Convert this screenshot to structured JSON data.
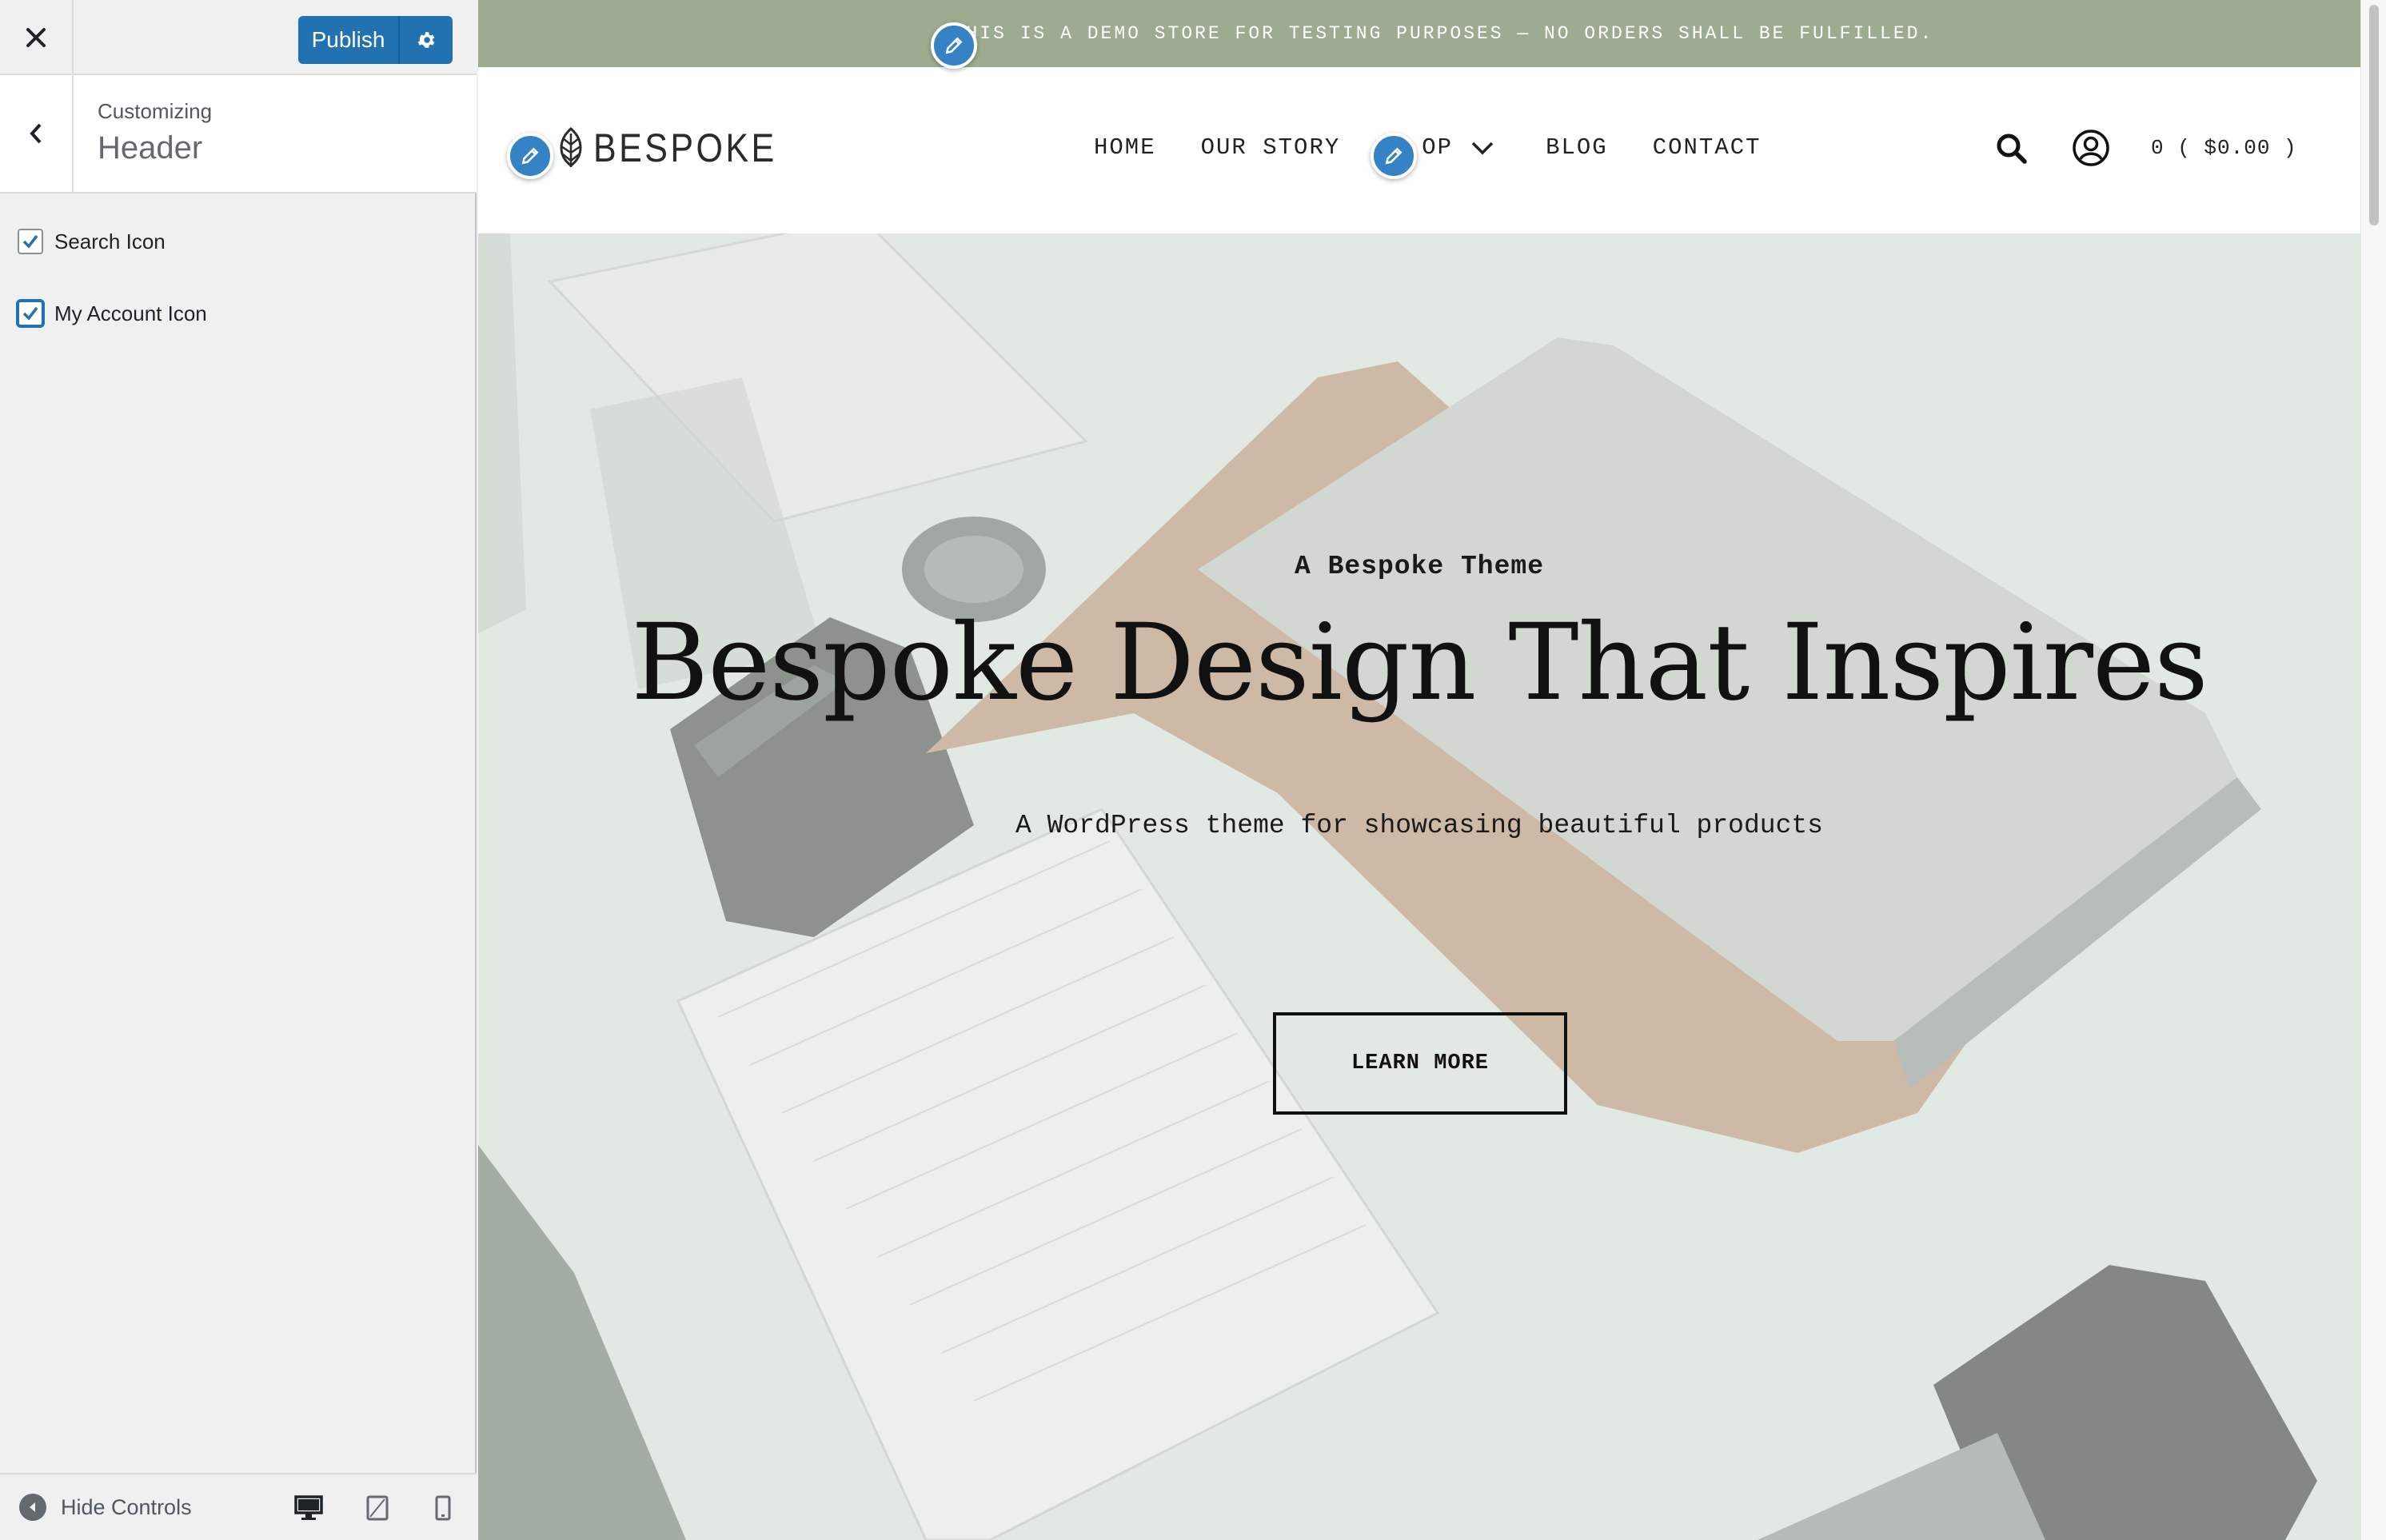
{
  "customizer": {
    "publish_label": "Publish",
    "customizing_label": "Customizing",
    "section_title": "Header",
    "options": [
      {
        "label": "Search Icon",
        "checked": true
      },
      {
        "label": "My Account Icon",
        "checked": true
      }
    ],
    "hide_controls_label": "Hide Controls",
    "accent_color": "#2271b1"
  },
  "preview": {
    "notice": "THIS IS A DEMO STORE FOR TESTING PURPOSES — NO ORDERS SHALL BE FULFILLED.",
    "notice_bg": "#9dac91",
    "logo_text": "BESPOKE",
    "nav": [
      "HOME",
      "OUR STORY",
      "OP",
      "BLOG",
      "CONTACT"
    ],
    "cart": "0 ( $0.00 )",
    "hero": {
      "kicker": "A Bespoke Theme",
      "heading": "Bespoke Design That Inspires",
      "subheading": "A WordPress theme for showcasing beautiful products",
      "button": "LEARN MORE"
    }
  }
}
